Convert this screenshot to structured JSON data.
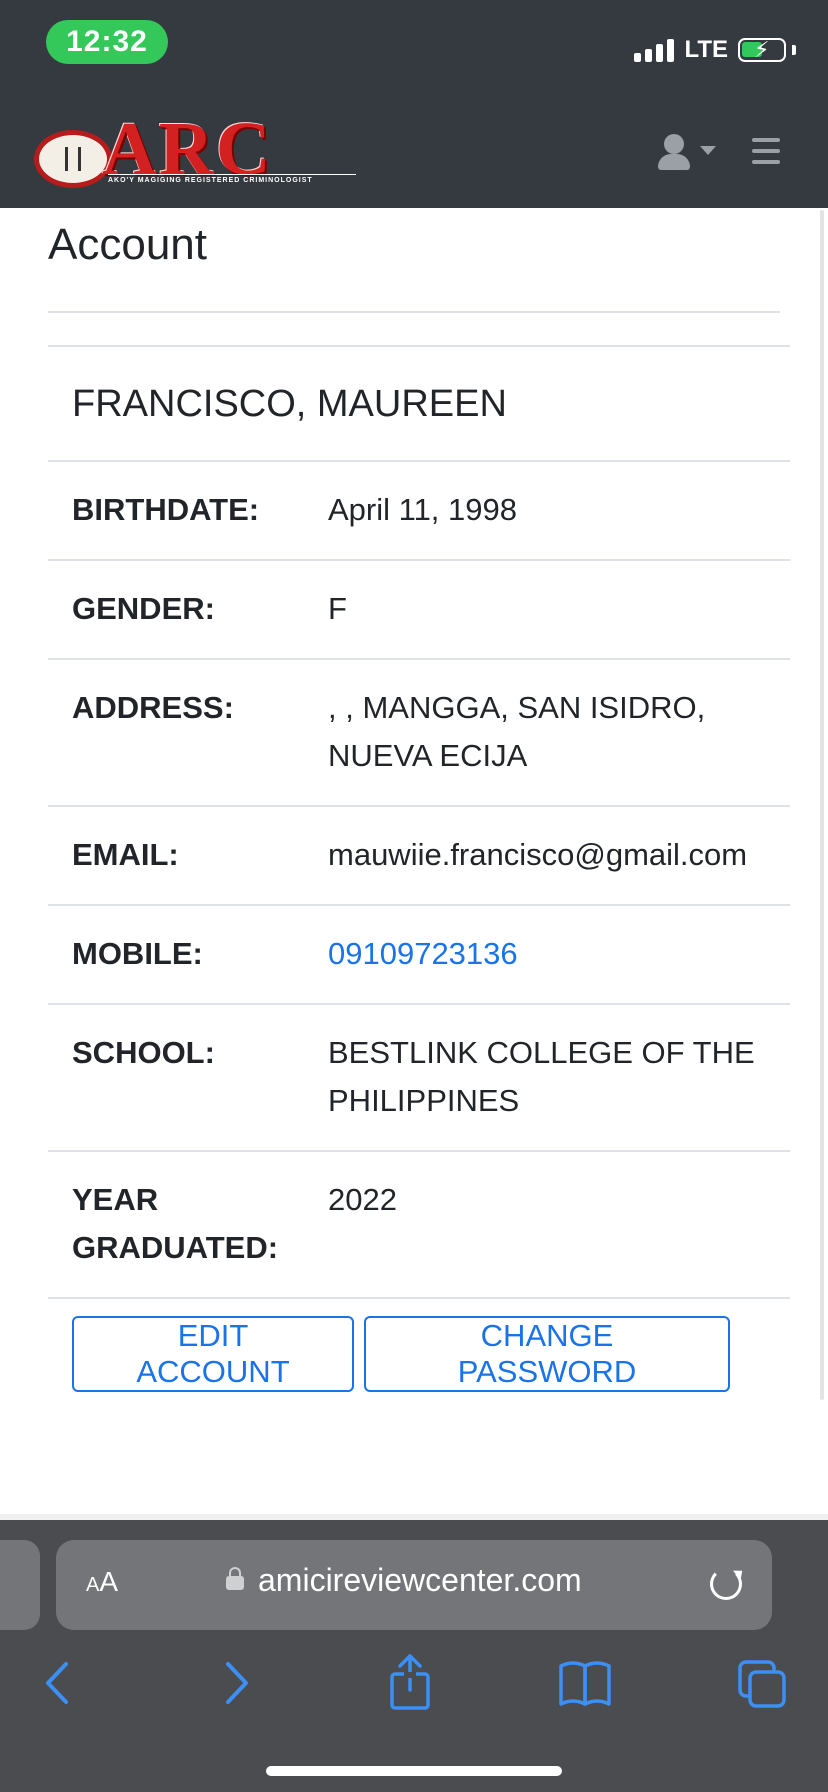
{
  "status_bar": {
    "time": "12:32",
    "network": "LTE"
  },
  "navbar": {
    "brand": "ARC",
    "tagline": "AKO'Y MAGIGING REGISTERED CRIMINOLOGIST"
  },
  "page": {
    "title": "Account"
  },
  "profile": {
    "name": "FRANCISCO, MAUREEN",
    "fields": [
      {
        "label": "BIRTHDATE:",
        "value": "April 11, 1998"
      },
      {
        "label": "GENDER:",
        "value": "F"
      },
      {
        "label": "ADDRESS:",
        "value": ", , MANGGA, SAN ISIDRO, NUEVA ECIJA"
      },
      {
        "label": "EMAIL:",
        "value": "mauwiie.francisco@gmail.com"
      },
      {
        "label": "MOBILE:",
        "value": "09109723136"
      },
      {
        "label": "SCHOOL:",
        "value": "BESTLINK COLLEGE OF THE PHILIPPINES"
      },
      {
        "label": "YEAR GRADUATED:",
        "value": "2022"
      }
    ]
  },
  "actions": {
    "edit_label": "EDIT ACCOUNT",
    "password_label": "CHANGE PASSWORD"
  },
  "browser": {
    "text_size_label": "AA",
    "domain": "amicireviewcenter.com",
    "toolbar_icons": [
      "back-icon",
      "forward-icon",
      "share-icon",
      "bookmarks-icon",
      "tabs-icon"
    ]
  },
  "colors": {
    "navbar": "#343a40",
    "accent": "#1a73e8",
    "time_pill": "#34c759",
    "logo_red": "#d32020"
  }
}
